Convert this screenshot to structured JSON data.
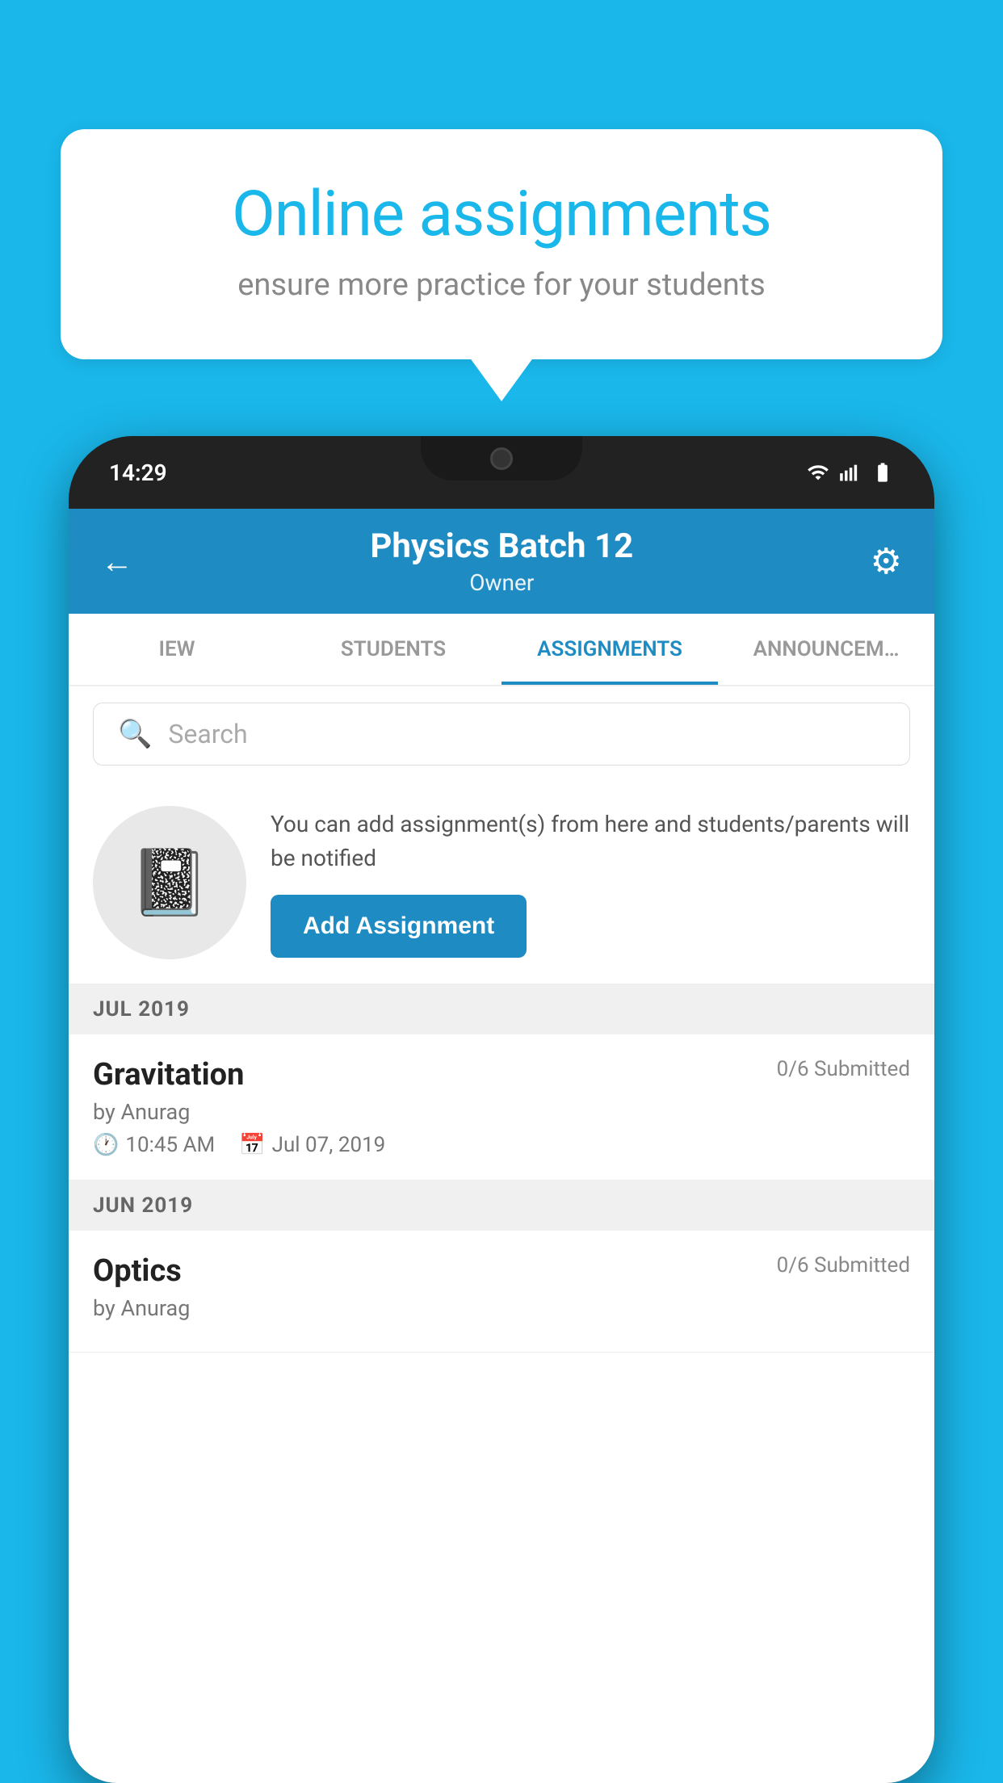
{
  "background_color": "#1ab7ea",
  "speech_bubble": {
    "title": "Online assignments",
    "subtitle": "ensure more practice for your students"
  },
  "phone": {
    "status_bar": {
      "time": "14:29",
      "icons": [
        "wifi",
        "signal",
        "battery"
      ]
    },
    "header": {
      "title": "Physics Batch 12",
      "subtitle": "Owner",
      "back_label": "←",
      "gear_label": "⚙"
    },
    "tabs": [
      {
        "label": "IEW",
        "active": false
      },
      {
        "label": "STUDENTS",
        "active": false
      },
      {
        "label": "ASSIGNMENTS",
        "active": true
      },
      {
        "label": "ANNOUNCEM…",
        "active": false
      }
    ],
    "search": {
      "placeholder": "Search"
    },
    "promo": {
      "description": "You can add assignment(s) from here and students/parents will be notified",
      "button_label": "Add Assignment"
    },
    "sections": [
      {
        "header": "JUL 2019",
        "assignments": [
          {
            "title": "Gravitation",
            "submitted": "0/6 Submitted",
            "author": "by Anurag",
            "time": "10:45 AM",
            "date": "Jul 07, 2019"
          }
        ]
      },
      {
        "header": "JUN 2019",
        "assignments": [
          {
            "title": "Optics",
            "submitted": "0/6 Submitted",
            "author": "by Anurag",
            "time": "",
            "date": ""
          }
        ]
      }
    ]
  }
}
